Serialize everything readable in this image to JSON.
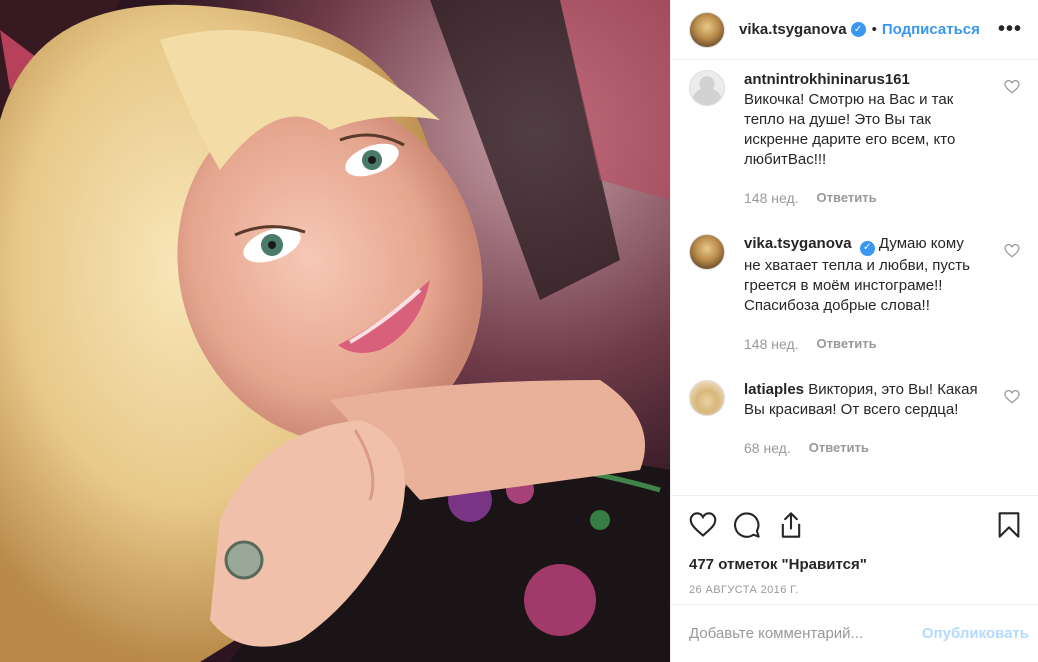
{
  "post": {
    "author": "vika.tsyganova",
    "follow_label": "Подписаться",
    "dot": "•",
    "more_label": "•••"
  },
  "comments": [
    {
      "username": "antnintrokhininarus161",
      "text": "Викочка! Смотрю на Вас и так тепло на душе! Это Вы так искренне дарите его всем, кто любитВас!!!",
      "time": "148 нед.",
      "reply_label": "Ответить",
      "verified": false
    },
    {
      "username": "vika.tsyganova",
      "text": "Думаю кому не хватает тепла и любви, пусть греется в моём инстограме!! Спасибоза добрые слова!!",
      "time": "148 нед.",
      "reply_label": "Ответить",
      "verified": true
    },
    {
      "username": "latiaples",
      "text": "Виктория, это Вы! Какая Вы красивая! От всего сердца!",
      "time": "68 нед.",
      "reply_label": "Ответить",
      "verified": false
    }
  ],
  "likes_text": "477 отметок \"Нравится\"",
  "date_text": "26 августа 2016 г.",
  "comment_box": {
    "placeholder": "Добавьте комментарий...",
    "publish_label": "Опубликовать"
  },
  "colors": {
    "accent": "#3897f0",
    "publish_disabled": "#b3dbff",
    "muted": "#999999"
  },
  "icons": [
    "heart-icon",
    "comment-icon",
    "share-icon",
    "bookmark-icon",
    "verified-icon"
  ]
}
